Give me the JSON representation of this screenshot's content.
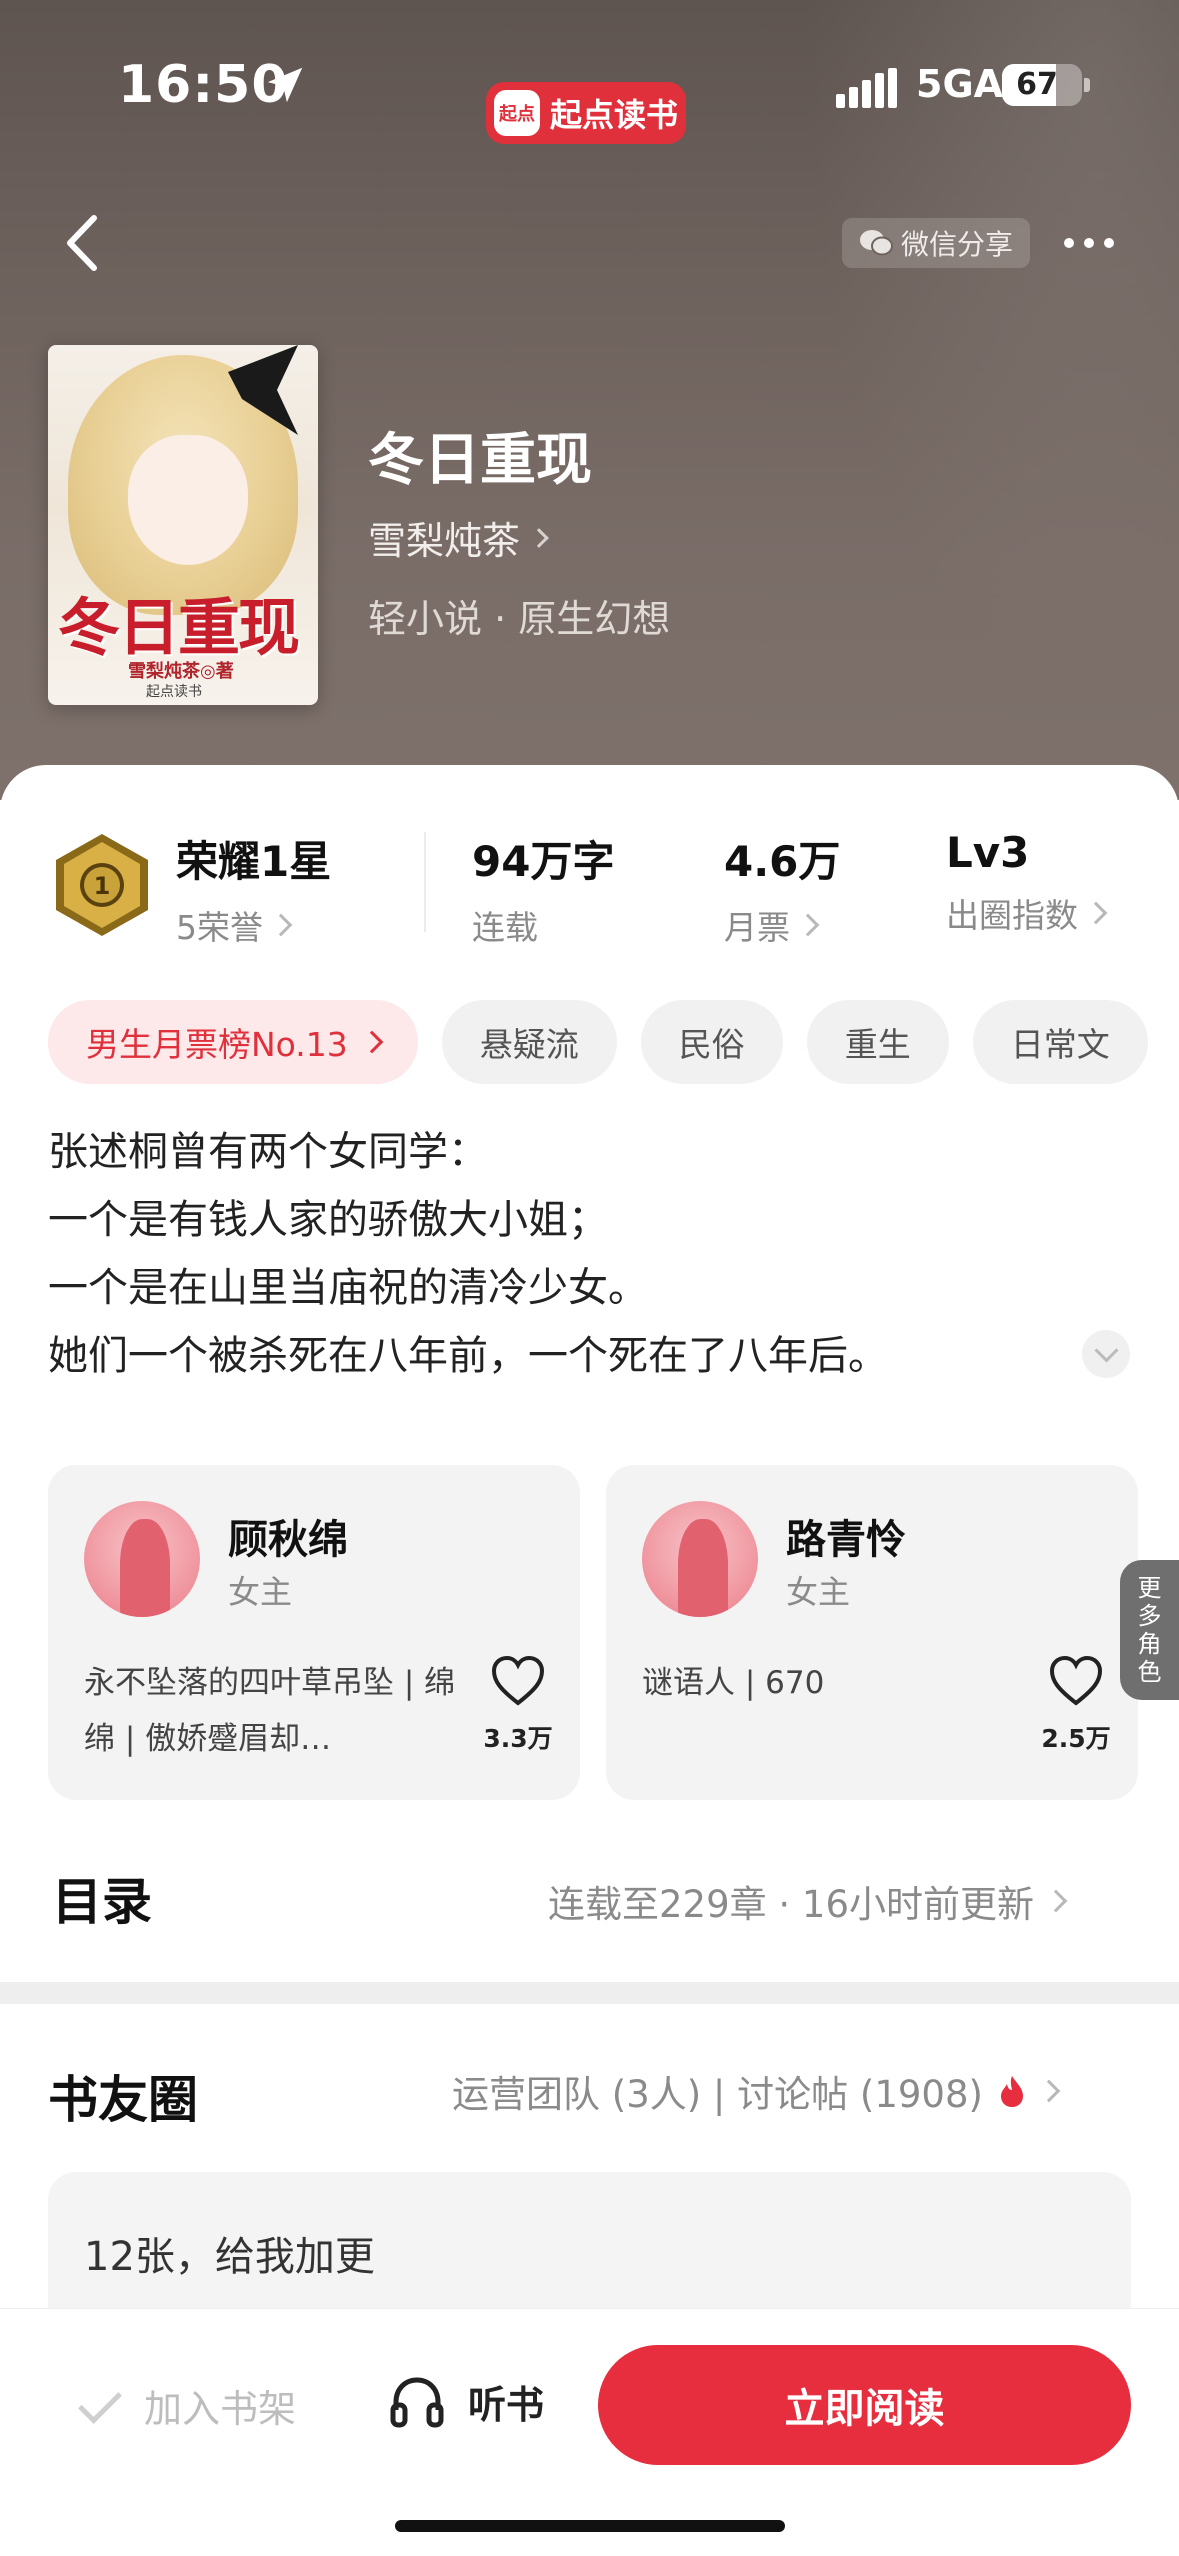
{
  "status_bar": {
    "time": "16:50",
    "network": "5GA",
    "battery": "67",
    "battery_level": 0.67
  },
  "app_badge": {
    "logo_text": "起点",
    "name": "起点读书"
  },
  "nav": {
    "share_label": "微信分享"
  },
  "book": {
    "cover_title": "冬日重现",
    "cover_author": "雪梨炖茶◎著",
    "cover_publisher": "起点读书",
    "title": "冬日重现",
    "author": "雪梨炖茶",
    "category": "轻小说 · 原生幻想"
  },
  "stats": {
    "honor": {
      "value": "荣耀1星",
      "label": "5荣誉"
    },
    "words": {
      "value": "94万字",
      "label": "连载"
    },
    "votes": {
      "value": "4.6万",
      "label": "月票"
    },
    "level": {
      "value": "Lv3",
      "label": "出圈指数"
    }
  },
  "tags": [
    "男生月票榜No.13",
    "悬疑流",
    "民俗",
    "重生",
    "日常文"
  ],
  "synopsis": [
    "张述桐曾有两个女同学：",
    "一个是有钱人家的骄傲大小姐；",
    "一个是在山里当庙祝的清冷少女。",
    "她们一个被杀死在八年前，一个死在了八年后。"
  ],
  "characters": [
    {
      "name": "顾秋绵",
      "role": "女主",
      "desc": "永不坠落的四叶草吊坠 | 绵绵 | 傲娇蹙眉却…",
      "likes": "3.3万"
    },
    {
      "name": "路青怜",
      "role": "女主",
      "desc": "谜语人 | 670",
      "likes": "2.5万"
    }
  ],
  "more_characters": "更多角色",
  "catalog": {
    "title": "目录",
    "meta": "连载至229章 · 16小时前更新"
  },
  "circle": {
    "title": "书友圈",
    "meta": "运营团队 (3人) | 讨论帖 (1908)",
    "post": "12张，给我加更"
  },
  "bottom_bar": {
    "shelf": "加入书架",
    "listen": "听书",
    "read": "立即阅读"
  },
  "colors": {
    "accent": "#e72e3e",
    "tag_bg": "#f1f1f1",
    "rank_tag_bg": "#fde8ea"
  }
}
